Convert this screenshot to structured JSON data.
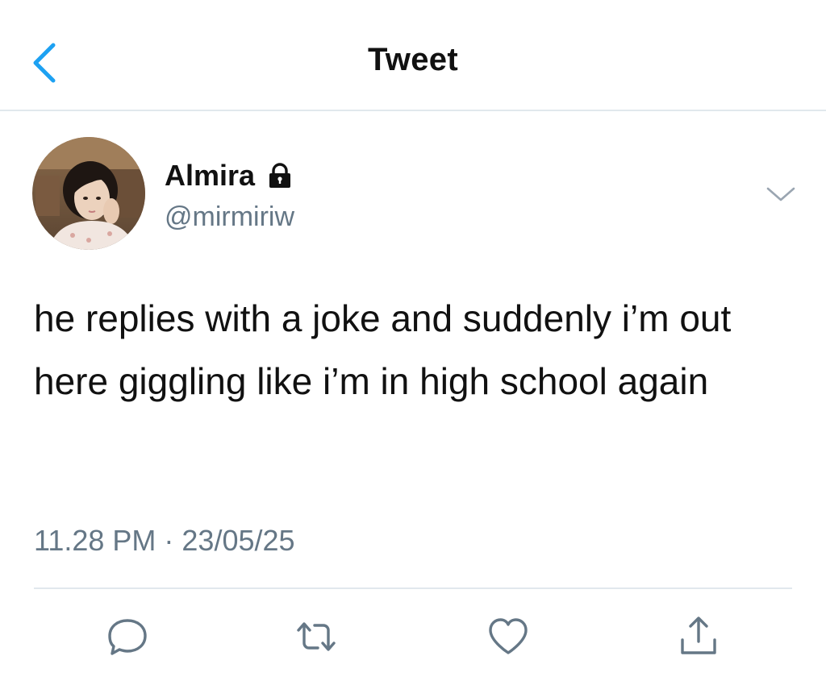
{
  "header": {
    "title": "Tweet",
    "back_icon": "chevron-left-icon",
    "accent_color": "#1da1f2"
  },
  "author": {
    "display_name": "Almira",
    "handle": "@mirmiriw",
    "protected_icon": "lock-icon",
    "avatar_icon": "avatar"
  },
  "tweet": {
    "text": "he replies with a joke and suddenly i’m out here giggling like i’m in high school again",
    "timestamp": "11.28 PM · 23/05/25"
  },
  "actions": [
    {
      "name": "reply",
      "icon": "comment-icon"
    },
    {
      "name": "retweet",
      "icon": "retweet-icon"
    },
    {
      "name": "like",
      "icon": "heart-icon"
    },
    {
      "name": "share",
      "icon": "share-icon"
    }
  ],
  "colors": {
    "text": "#111111",
    "secondary": "#657786",
    "divider": "#e1e8ed"
  }
}
